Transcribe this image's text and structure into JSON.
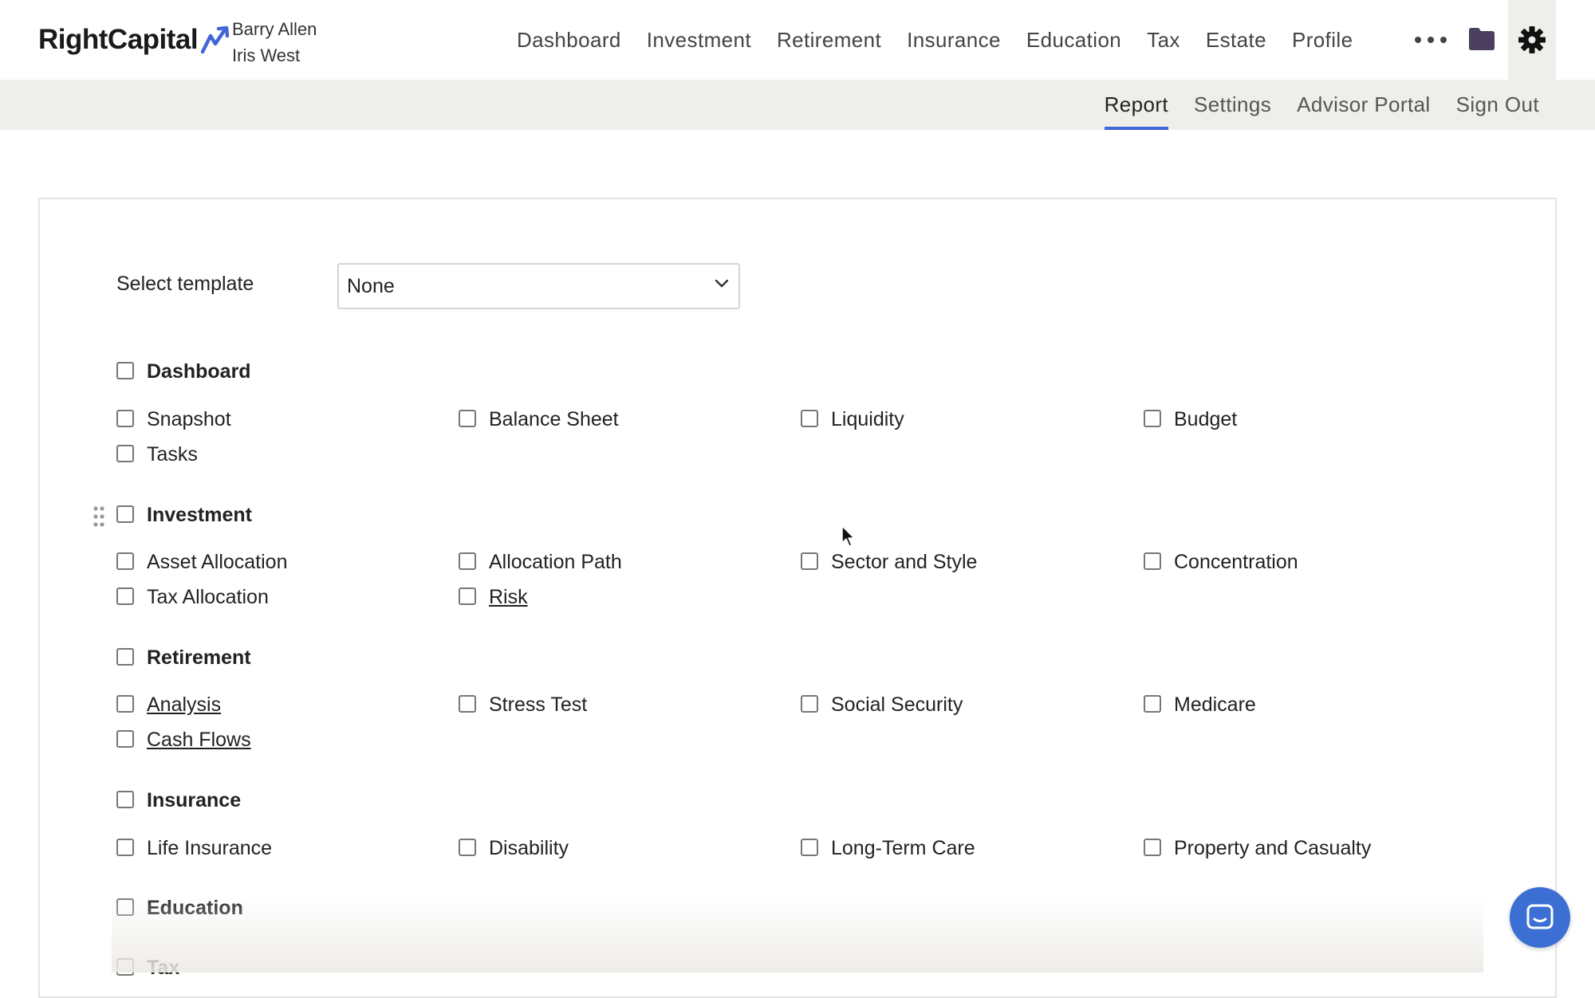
{
  "brand": {
    "name": "RightCapital"
  },
  "clients": [
    "Barry Allen",
    "Iris West"
  ],
  "main_nav": [
    "Dashboard",
    "Investment",
    "Retirement",
    "Insurance",
    "Education",
    "Tax",
    "Estate",
    "Profile"
  ],
  "sub_nav": {
    "items": [
      "Report",
      "Settings",
      "Advisor Portal",
      "Sign Out"
    ],
    "active": "Report"
  },
  "template": {
    "label": "Select template",
    "selected": "None"
  },
  "sections": [
    {
      "title": "Dashboard",
      "items": [
        "Snapshot",
        "Balance Sheet",
        "Liquidity",
        "Budget",
        "Tasks"
      ]
    },
    {
      "title": "Investment",
      "items": [
        "Asset Allocation",
        "Allocation Path",
        "Sector and Style",
        "Concentration",
        "Tax Allocation",
        "Risk"
      ]
    },
    {
      "title": "Retirement",
      "items": [
        "Analysis",
        "Stress Test",
        "Social Security",
        "Medicare",
        "Cash Flows"
      ]
    },
    {
      "title": "Insurance",
      "items": [
        "Life Insurance",
        "Disability",
        "Long-Term Care",
        "Property and Casualty"
      ]
    },
    {
      "title": "Education",
      "items": []
    },
    {
      "title": "Tax",
      "items": []
    }
  ],
  "colors": {
    "accent": "#4066d8",
    "chat": "#3b6fd4",
    "subbar": "#eeeeea"
  },
  "icons": [
    "logo-arrow-icon",
    "more-icon",
    "folder-icon",
    "gear-icon",
    "chevron-down-icon",
    "drag-handle-icon",
    "chat-icon",
    "mouse-cursor-icon"
  ]
}
